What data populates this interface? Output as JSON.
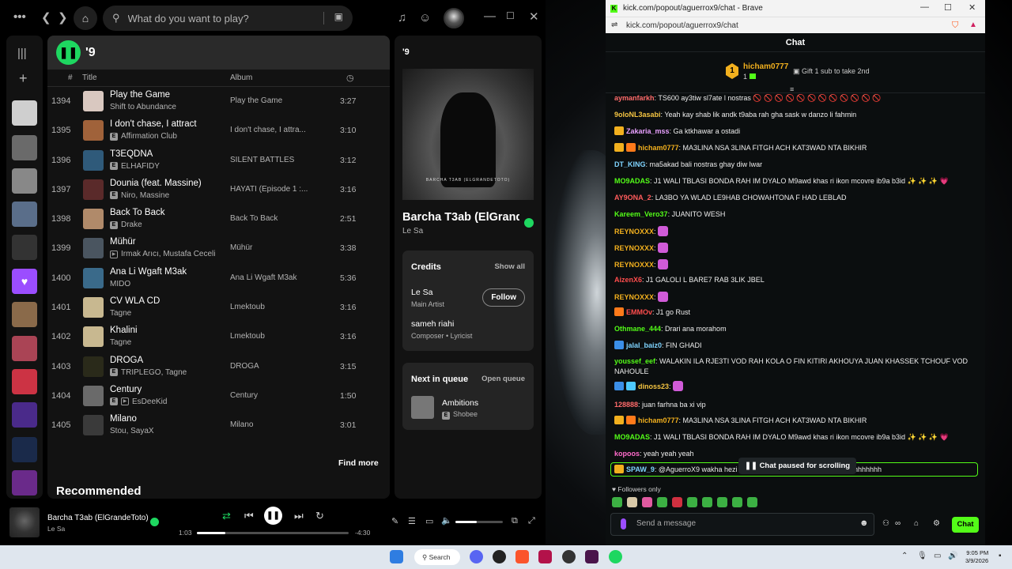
{
  "spotify": {
    "search_placeholder": "What do you want to play?",
    "playlist_title": "'9",
    "columns": {
      "num": "#",
      "title": "Title",
      "album": "Album"
    },
    "tracks": [
      {
        "num": "1394",
        "title": "Play the Game",
        "artist": "Shift to Abundance",
        "album": "Play the Game",
        "duration": "3:27",
        "explicit": false,
        "video": false,
        "color": "#d9c8c0"
      },
      {
        "num": "1395",
        "title": "I don't chase, I attract",
        "artist": "Affirmation Club",
        "album": "I don't chase, I attra...",
        "duration": "3:10",
        "explicit": true,
        "video": false,
        "color": "#a0623a"
      },
      {
        "num": "1396",
        "title": "T3EQDNA",
        "artist": "ELHAFIDY",
        "album": "SILENT BATTLES",
        "duration": "3:12",
        "explicit": true,
        "video": false,
        "color": "#2f5a7a"
      },
      {
        "num": "1397",
        "title": "Dounia (feat. Massine)",
        "artist": "Niro, Massine",
        "album": "HAYATI (Episode 1 :...",
        "duration": "3:16",
        "explicit": true,
        "video": false,
        "color": "#5a2a2a"
      },
      {
        "num": "1398",
        "title": "Back To Back",
        "artist": "Drake",
        "album": "Back To Back",
        "duration": "2:51",
        "explicit": true,
        "video": false,
        "color": "#b08a6a"
      },
      {
        "num": "1399",
        "title": "Mühür",
        "artist": "Irmak Arıcı, Mustafa Ceceli",
        "album": "Mühür",
        "duration": "3:38",
        "explicit": false,
        "video": true,
        "color": "#4a5560"
      },
      {
        "num": "1400",
        "title": "Ana Li Wgaft M3ak",
        "artist": "MIDO",
        "album": "Ana Li Wgaft M3ak",
        "duration": "5:36",
        "explicit": false,
        "video": false,
        "color": "#3a6a8a"
      },
      {
        "num": "1401",
        "title": "CV WLA CD",
        "artist": "Tagne",
        "album": "Lmektoub",
        "duration": "3:16",
        "explicit": false,
        "video": false,
        "color": "#c8b890"
      },
      {
        "num": "1402",
        "title": "Khalini",
        "artist": "Tagne",
        "album": "Lmektoub",
        "duration": "3:16",
        "explicit": false,
        "video": false,
        "color": "#c8b890"
      },
      {
        "num": "1403",
        "title": "DROGA",
        "artist": "TRIPLEGO, Tagne",
        "album": "DROGA",
        "duration": "3:15",
        "explicit": true,
        "video": false,
        "color": "#2a2a1a"
      },
      {
        "num": "1404",
        "title": "Century",
        "artist": "EsDeeKid",
        "album": "Century",
        "duration": "1:50",
        "explicit": true,
        "video": true,
        "color": "#6a6a6a"
      },
      {
        "num": "1405",
        "title": "Milano",
        "artist": "Stou, SayaX",
        "album": "Milano",
        "duration": "3:01",
        "explicit": false,
        "video": false,
        "color": "#3a3a3a"
      }
    ],
    "find_more": "Find more",
    "recommended": "Recommended",
    "right": {
      "title": "'9",
      "cover_text": "BARCHA T3AB (ELGRANDETOTO)",
      "song": "Barcha T3ab (ElGrandeToto)",
      "artist": "Le Sa",
      "credits_title": "Credits",
      "show_all": "Show all",
      "credit1_name": "Le Sa",
      "credit1_role": "Main Artist",
      "follow": "Follow",
      "credit2_name": "sameh riahi",
      "credit2_role": "Composer • Lyricist",
      "queue_title": "Next in queue",
      "open_queue": "Open queue",
      "queue_song": "Ambitions",
      "queue_artist": "Shobee"
    },
    "player": {
      "song": "Barcha T3ab (ElGrandeToto)",
      "artist": "Le Sa",
      "elapsed": "1:03",
      "remaining": "-4:30",
      "progress": 0.19,
      "volume": 0.45
    }
  },
  "brave": {
    "window_title": "kick.com/popout/aguerrox9/chat - Brave",
    "url": "kick.com/popout/aguerrox9/chat",
    "chat_header": "Chat",
    "pinned": {
      "rank": "1",
      "user": "hicham0777",
      "count": "1",
      "gift": "Gift 1 sub to take 2nd"
    },
    "messages": [
      {
        "user": "aymanfarkh",
        "color": "#ff6b6b",
        "text": ": TS600 ay3tiw sl7ate l nostras 🚫 🚫 🚫 🚫 🚫 🚫 🚫 🚫 🚫 🚫 🚫 🚫",
        "badges": []
      },
      {
        "user": "9oloNL3asabi",
        "color": "#f5c542",
        "text": ": Yeah kay shab lik andk t9aba rah gha sask w danzo li fahmin",
        "badges": []
      },
      {
        "user": "Zakaria_mss",
        "color": "#e8a0ff",
        "text": ": Ga ktkhawar a ostadi",
        "badges": [
          "#f2b01e"
        ]
      },
      {
        "user": "hicham0777",
        "color": "#f2b01e",
        "text": ": MA3LINA NSA 3LINA FITGH ACH KAT3WAD NTA BIKHIR",
        "badges": [
          "#f2b01e",
          "#ff7a1a"
        ]
      },
      {
        "user": "DT_KING",
        "color": "#7fd4ff",
        "text": ": ma5akad bali nostras ghay diw lwar",
        "badges": []
      },
      {
        "user": "MO9ADAS",
        "color": "#53fc18",
        "text": ": J1 WALI TBLASI BONDA RAH IM DYALO M9awd khas ri ikon mcovre ib9a b3id ✨ ✨ ✨ 💗",
        "badges": []
      },
      {
        "user": "AY9ONA_2",
        "color": "#ff5c5c",
        "text": ": LA3BO YA WLAD LE9HAB CHOWAHTONA F HAD LEBLAD",
        "badges": []
      },
      {
        "user": "Kareem_Vero37",
        "color": "#53fc18",
        "text": ": JUANITO WESH",
        "badges": []
      },
      {
        "user": "REYNOXXX",
        "color": "#f2b01e",
        "text": ":",
        "badges": [],
        "emote": true
      },
      {
        "user": "REYNOXXX",
        "color": "#f2b01e",
        "text": ":",
        "badges": [],
        "emote": true
      },
      {
        "user": "REYNOXXX",
        "color": "#f2b01e",
        "text": ":",
        "badges": [],
        "emote": true
      },
      {
        "user": "AizenX6",
        "color": "#ff4d4d",
        "text": ": J1 GALOLI L BARE7 RAB 3LIK JBEL",
        "badges": []
      },
      {
        "user": "REYNOXXX",
        "color": "#f2b01e",
        "text": ":",
        "badges": [],
        "emote": true
      },
      {
        "user": "EMMOv",
        "color": "#ff4d4d",
        "text": ": J1 go Rust",
        "badges": [
          "#ff7a1a"
        ]
      },
      {
        "user": "Othmane_444",
        "color": "#53fc18",
        "text": ": Drari ana morahom",
        "badges": []
      },
      {
        "user": "jalal_baiz0",
        "color": "#7fd4ff",
        "text": ": FIN GHADI",
        "badges": [
          "#3b8fe8"
        ]
      },
      {
        "user": "youssef_eef",
        "color": "#53fc18",
        "text": ": WALAKIN ILA RJE3TI VOD RAH KOLA O FIN KITIRI AKHOUYA JUAN KHASSEK TCHOUF VOD NAHOULE",
        "badges": []
      },
      {
        "user": "dinoss23",
        "color": "#f5c542",
        "text": ":",
        "badges": [
          "#3b8fe8",
          "#4ec9ff"
        ],
        "emote": true
      },
      {
        "user": "128888",
        "color": "#ff6b6b",
        "text": ": juan farhna ba xi vip",
        "badges": []
      },
      {
        "user": "hicham0777",
        "color": "#f2b01e",
        "text": ": MA3LINA NSA 3LINA FITGH ACH KAT3WAD NTA BIKHIR",
        "badges": [
          "#f2b01e",
          "#ff7a1a"
        ]
      },
      {
        "user": "MO9ADAS",
        "color": "#53fc18",
        "text": ": J1 WALI TBLASI BONDA RAH IM DYALO M9awd khas ri ikon mcovre ib9a b3id ✨ ✨ ✨ 💗",
        "badges": []
      },
      {
        "user": "kopoos",
        "color": "#ff6bcb",
        "text": ": yeah yeah yeah",
        "badges": []
      }
    ],
    "last_user": "SPAW_9",
    "last_text": ": @AguerroX9 wakha hezi",
    "last_tail": "hhhhhhh",
    "paused": "Chat paused for scrolling",
    "followers": "Followers only",
    "placeholder": "Send a message",
    "chat_button": "Chat"
  },
  "taskbar": {
    "search": "Search",
    "time": "9:05 PM",
    "date": "3/9/2026"
  }
}
